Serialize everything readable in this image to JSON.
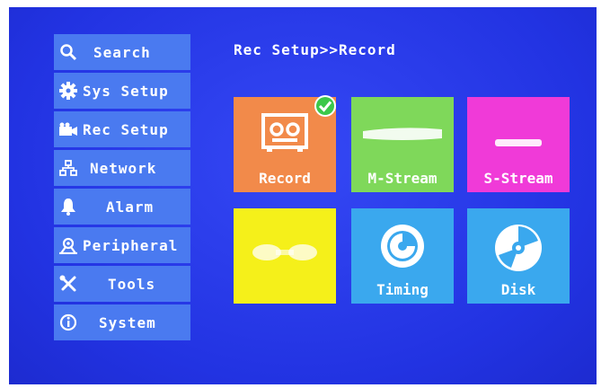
{
  "sidebar": {
    "items": [
      {
        "label": "Search",
        "icon": "search-icon"
      },
      {
        "label": "Sys Setup",
        "icon": "gear-icon"
      },
      {
        "label": "Rec Setup",
        "icon": "camera-icon"
      },
      {
        "label": "Network",
        "icon": "network-icon"
      },
      {
        "label": "Alarm",
        "icon": "bell-icon"
      },
      {
        "label": "Peripheral",
        "icon": "peripheral-icon"
      },
      {
        "label": "Tools",
        "icon": "tools-icon"
      },
      {
        "label": "System",
        "icon": "info-icon"
      }
    ]
  },
  "breadcrumb": "Rec Setup>>Record",
  "tiles": [
    {
      "label": "Record",
      "color": "#f28a4a",
      "icon": "tape-recorder-icon",
      "selected": true
    },
    {
      "label": "M-Stream",
      "color": "#7fd85a",
      "icon": "main-stream-icon"
    },
    {
      "label": "S-Stream",
      "color": "#f03ad8",
      "icon": "sub-stream-icon"
    },
    {
      "label": "",
      "color": "#f5f01a",
      "icon": "snapshot-icon"
    },
    {
      "label": "Timing",
      "color": "#3aa8ee",
      "icon": "timer-icon"
    },
    {
      "label": "Disk",
      "color": "#3aa8ee",
      "icon": "disk-icon"
    }
  ],
  "colors": {
    "screen_bg": "#2a3df0",
    "sidebar_item_bg": "#4a7af0"
  }
}
